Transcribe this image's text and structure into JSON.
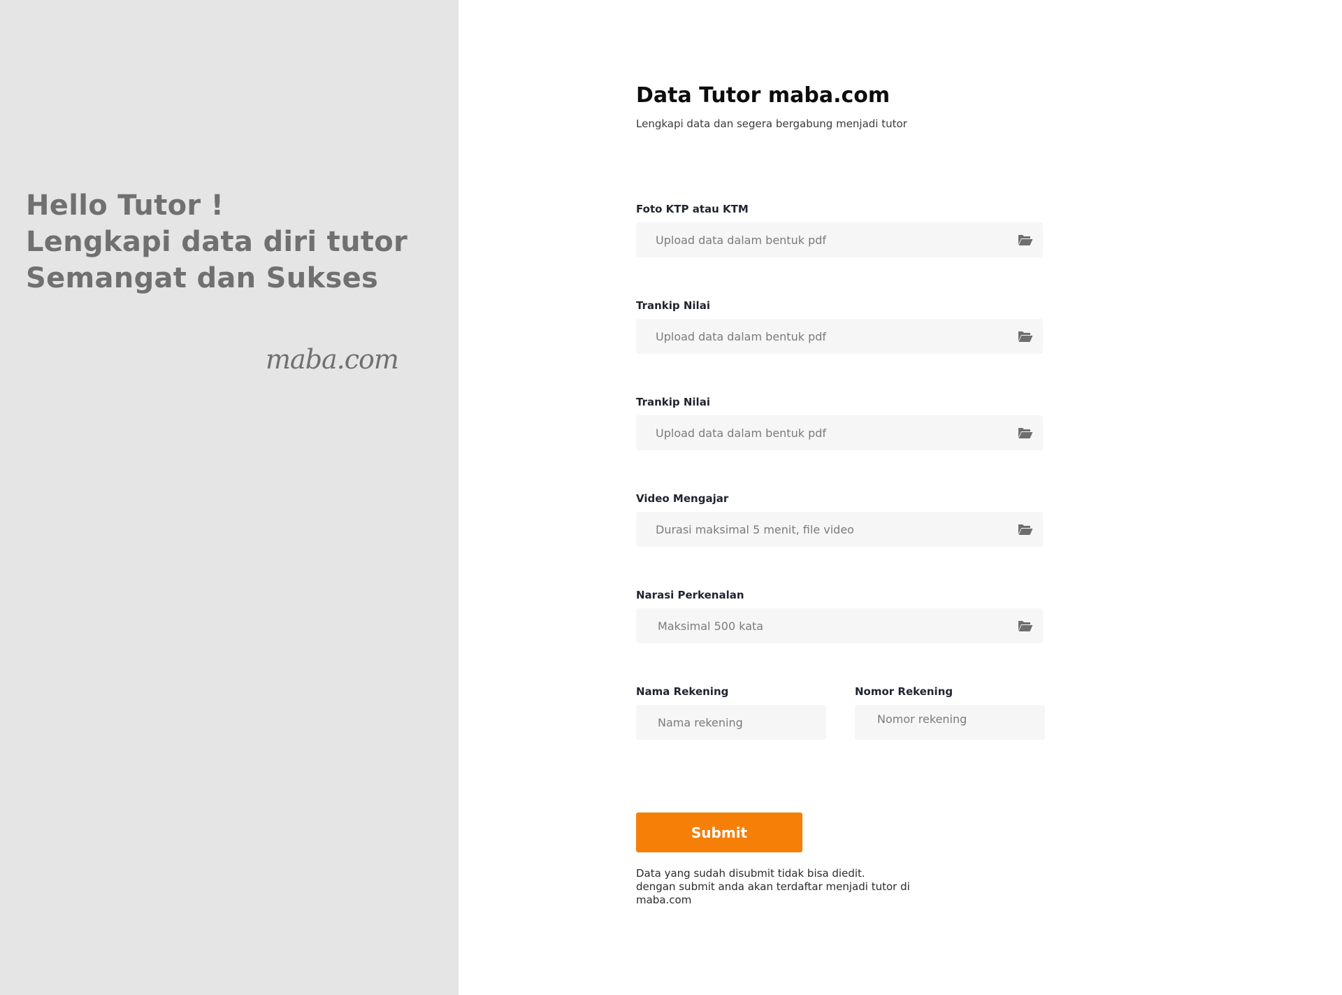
{
  "left_panel": {
    "greeting_lines": [
      "Hello Tutor !",
      "Lengkapi data diri tutor",
      "Semangat dan Sukses"
    ],
    "brand": "maba.com"
  },
  "header": {
    "title": "Data Tutor maba.com",
    "subtitle": "Lengkapi data dan segera bergabung menjadi tutor"
  },
  "fields": [
    {
      "label": "Foto KTP atau KTM",
      "placeholder": "Upload data dalam bentuk pdf",
      "icon": "folder-open-icon"
    },
    {
      "label": "Trankip Nilai",
      "placeholder": "Upload data dalam bentuk pdf",
      "icon": "folder-open-icon"
    },
    {
      "label": "Trankip Nilai",
      "placeholder": "Upload data dalam bentuk pdf",
      "icon": "folder-open-icon"
    },
    {
      "label": "Video Mengajar",
      "placeholder": "Durasi maksimal 5 menit, file video",
      "icon": "folder-open-icon"
    },
    {
      "label": "Narasi Perkenalan",
      "placeholder": "Maksimal 500 kata",
      "icon": "folder-open-icon"
    }
  ],
  "account": {
    "name_label": "Nama Rekening",
    "name_placeholder": "Nama rekening",
    "number_label": "Nomor Rekening",
    "number_placeholder": "Nomor rekening"
  },
  "submit": {
    "label": "Submit",
    "note_lines": [
      "Data yang sudah disubmit tidak bisa diedit.",
      "dengan submit anda akan terdaftar menjadi tutor di",
      "maba.com"
    ]
  },
  "colors": {
    "accent": "#f57f07",
    "left_panel_bg": "#e5e5e5",
    "input_bg": "#f7f6f7"
  }
}
